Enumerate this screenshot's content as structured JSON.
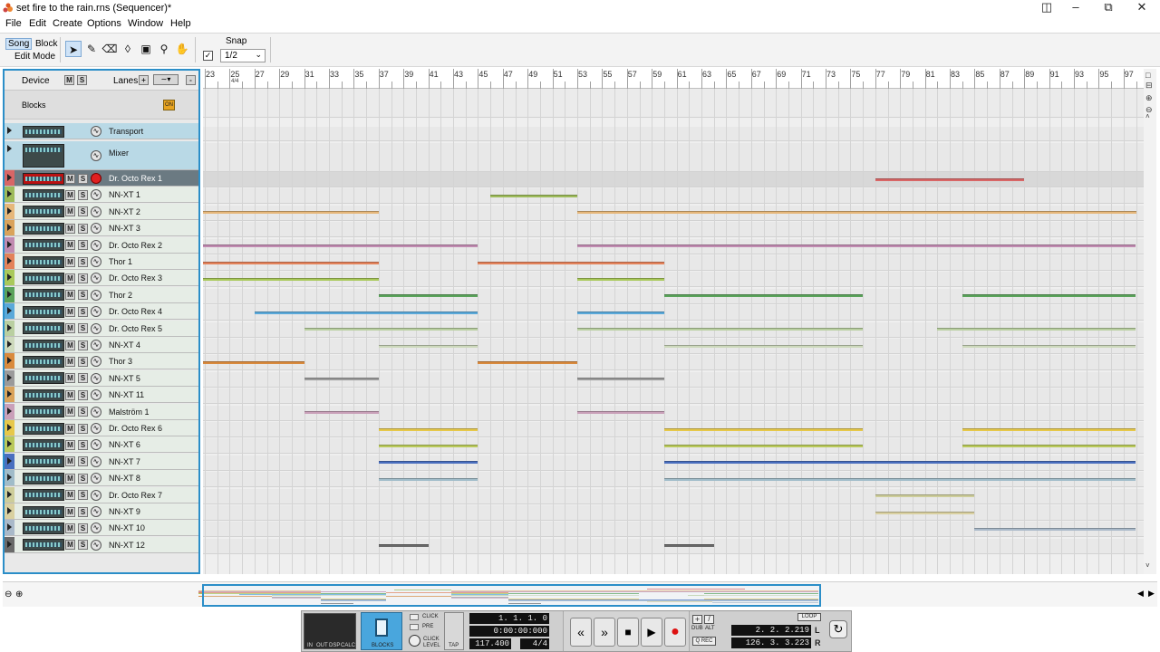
{
  "window": {
    "title": "set fire to the rain.rns (Sequencer)*"
  },
  "menu": [
    "File",
    "Edit",
    "Create",
    "Options",
    "Window",
    "Help"
  ],
  "toolbar": {
    "mode_song": "Song",
    "mode_block": "Block",
    "edit_mode": "Edit Mode",
    "snap_label": "Snap",
    "snap_value": "1/2",
    "tools": [
      "arrow-icon",
      "pencil-icon",
      "eraser-icon",
      "razor-icon",
      "mute-icon",
      "magnify-icon",
      "hand-icon"
    ]
  },
  "panel": {
    "device_label": "Device",
    "lanes_label": "Lanes",
    "blocks_label": "Blocks",
    "blocks_toggle": "ON",
    "m": "M",
    "s": "S"
  },
  "ruler": {
    "labels": [
      "23",
      "25",
      "27",
      "29",
      "31",
      "33",
      "35",
      "37",
      "39",
      "41",
      "43",
      "45",
      "47",
      "49",
      "51",
      "53",
      "55",
      "57",
      "59",
      "61",
      "63",
      "65",
      "67",
      "69",
      "71",
      "73",
      "75",
      "77",
      "79",
      "81",
      "83",
      "85",
      "87",
      "89",
      "91",
      "93",
      "95",
      "97"
    ],
    "time_sig": "4/4"
  },
  "tracks": [
    {
      "name": "Transport",
      "color": "#b9d9e6"
    },
    {
      "name": "Mixer",
      "color": "#b9d9e6"
    },
    {
      "name": "Dr. Octo Rex 1",
      "color": "#d86666"
    },
    {
      "name": "NN-XT 1",
      "color": "#9dbb5a"
    },
    {
      "name": "NN-XT 2",
      "color": "#e6b77a"
    },
    {
      "name": "NN-XT 3",
      "color": "#d9a35a"
    },
    {
      "name": "Dr. Octo Rex 2",
      "color": "#c08ab0"
    },
    {
      "name": "Thor 1",
      "color": "#e3825a"
    },
    {
      "name": "Dr. Octo Rex 3",
      "color": "#a9c95a"
    },
    {
      "name": "Thor 2",
      "color": "#5aa35a"
    },
    {
      "name": "Dr. Octo Rex 4",
      "color": "#5aa9d9"
    },
    {
      "name": "Dr. Octo Rex 5",
      "color": "#b9cfa0"
    },
    {
      "name": "NN-XT 4",
      "color": "#cdd9bc"
    },
    {
      "name": "Thor 3",
      "color": "#d98a3d"
    },
    {
      "name": "NN-XT 5",
      "color": "#9a9a9a"
    },
    {
      "name": "NN-XT 11",
      "color": "#d9a35a"
    },
    {
      "name": "Malström 1",
      "color": "#c9a0b9"
    },
    {
      "name": "Dr. Octo Rex 6",
      "color": "#e6c84a"
    },
    {
      "name": "NN-XT 6",
      "color": "#b9c95a"
    },
    {
      "name": "NN-XT 7",
      "color": "#4a6fbf"
    },
    {
      "name": "NN-XT 8",
      "color": "#a0bcc9"
    },
    {
      "name": "Dr. Octo Rex 7",
      "color": "#cdcd9a"
    },
    {
      "name": "NN-XT 9",
      "color": "#d9d0a0"
    },
    {
      "name": "NN-XT 10",
      "color": "#a9b9c9"
    },
    {
      "name": "NN-XT 12",
      "color": "#6a6a6a"
    }
  ],
  "transport": {
    "position": "1. 1. 1.   0",
    "time": "0:00:00:000",
    "tempo": "117.400",
    "signature": "4/4",
    "loop_left": "2. 2. 2.219",
    "loop_right": "126. 3. 3.223",
    "labels": {
      "in": "IN",
      "out": "OUT",
      "dsp": "DSP",
      "calc": "CALC",
      "blocks": "BLOCKS",
      "click": "CLICK",
      "pre": "PRE",
      "click_level": "CLICK LEVEL",
      "tap": "TAP",
      "dub": "DUB",
      "alt": "ALT",
      "q_rec": "Q REC",
      "loop": "LOOP",
      "l": "L",
      "r": "R"
    }
  }
}
